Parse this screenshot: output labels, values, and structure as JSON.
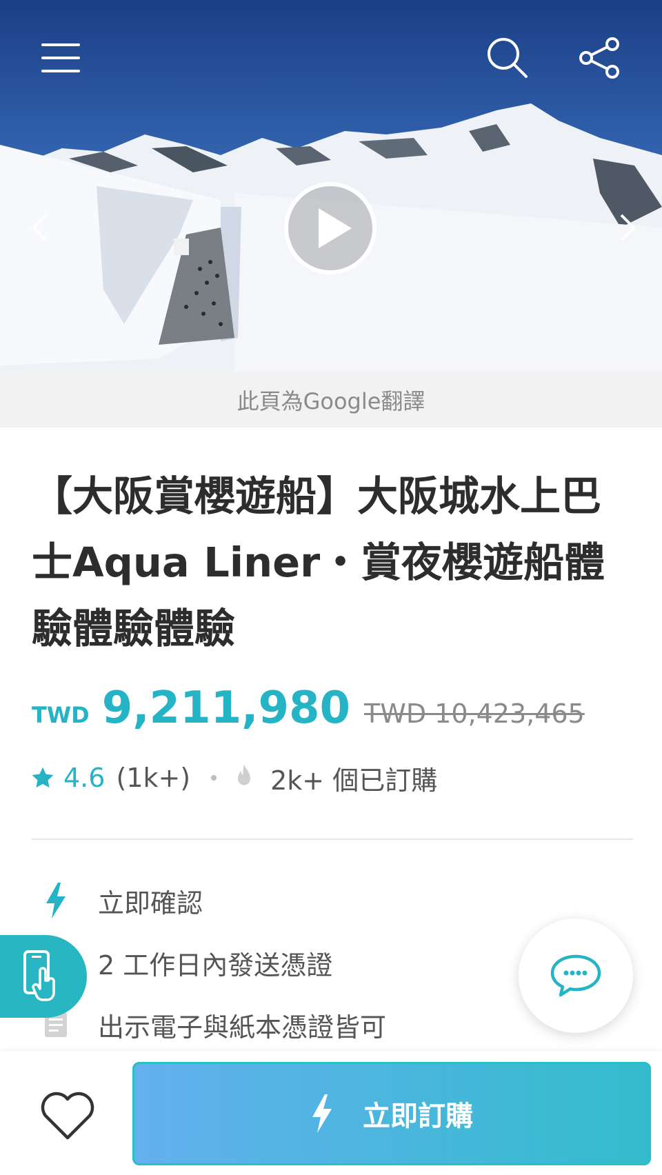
{
  "hero": {
    "menu_icon": "hamburger-menu-icon",
    "search_icon": "search-icon",
    "share_icon": "share-icon",
    "prev_icon": "chevron-left-icon",
    "next_icon": "chevron-right-icon",
    "play_icon": "play-icon"
  },
  "translate_note": "此頁為Google翻譯",
  "product": {
    "title": "【大阪賞櫻遊船】大阪城水上巴士Aqua Liner・賞夜櫻遊船體驗體驗體驗",
    "price_currency": "TWD",
    "price_value": "9,211,980",
    "price_original": "TWD 10,423,465",
    "rating": "4.6",
    "review_count": "(1k+)",
    "booked": "2k+ 個已訂購"
  },
  "features": [
    {
      "icon": "lightning-icon",
      "label": "立即確認"
    },
    {
      "icon": "clock-icon",
      "label": "2 工作日內發送憑證"
    },
    {
      "icon": "voucher-icon",
      "label": "出示電子與紙本憑證皆可"
    }
  ],
  "floating": {
    "phone_icon": "phone-tap-icon",
    "chat_icon": "chat-bubble-icon"
  },
  "bottom_bar": {
    "favorite_icon": "heart-icon",
    "book_label": "立即訂購"
  },
  "colors": {
    "accent": "#24b4c5",
    "button_gradient_start": "#63b0ee",
    "button_gradient_end": "#33bccd"
  }
}
